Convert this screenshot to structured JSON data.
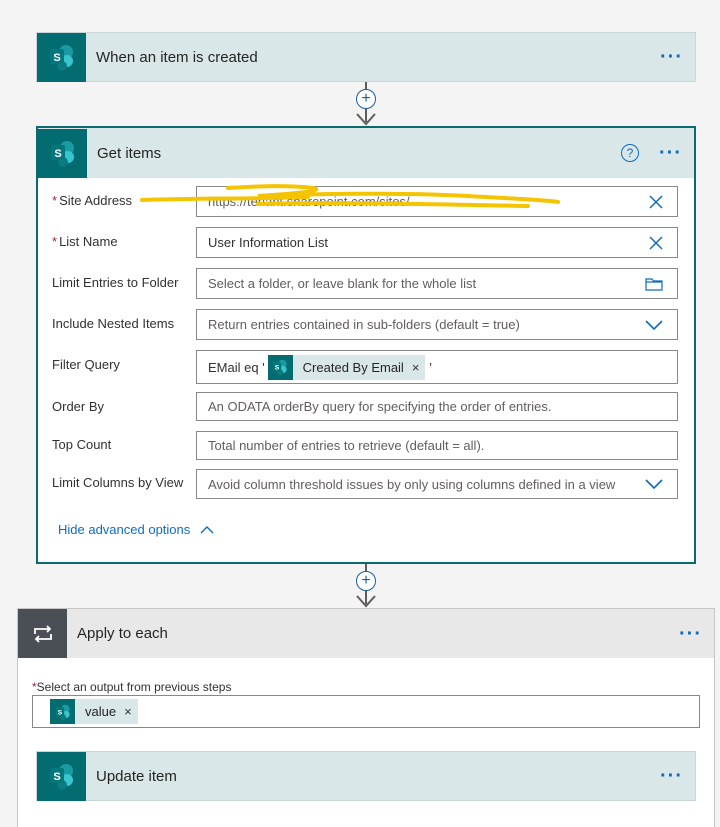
{
  "trigger": {
    "title": "When an item is created",
    "sp_letter": "S"
  },
  "get_items": {
    "title": "Get items",
    "help_glyph": "?",
    "fields": [
      {
        "label": "Site Address",
        "required": true,
        "value": "https://tenant.sharepoint.com/sites/...",
        "trail": "clear-icon"
      },
      {
        "label": "List Name",
        "required": true,
        "value": "User Information List",
        "trail": "clear-icon"
      },
      {
        "label": "Limit Entries to Folder",
        "required": false,
        "placeholder": "Select a folder, or leave blank for the whole list",
        "trail": "folder-icon"
      },
      {
        "label": "Include Nested Items",
        "required": false,
        "placeholder": "Return entries contained in sub-folders (default = true)",
        "trail": "chevron-down-icon"
      },
      {
        "label": "Filter Query",
        "required": false,
        "prefix": "EMail eq '",
        "token": "Created By Email",
        "suffix": "'"
      },
      {
        "label": "Order By",
        "required": false,
        "placeholder": "An ODATA orderBy query for specifying the order of entries."
      },
      {
        "label": "Top Count",
        "required": false,
        "placeholder": "Total number of entries to retrieve (default = all)."
      },
      {
        "label": "Limit Columns by View",
        "required": false,
        "placeholder": "Avoid column threshold issues by only using columns defined in a view",
        "trail": "chevron-down-icon"
      }
    ],
    "advanced_link": "Hide advanced options"
  },
  "apply_each": {
    "title": "Apply to each",
    "select_label": "Select an output from previous steps",
    "token": "value"
  },
  "update_item": {
    "title": "Update item"
  },
  "ui": {
    "more_glyph": "···",
    "remove_glyph": "×",
    "plus_glyph": "+",
    "required_mark": "*"
  },
  "colors": {
    "sharepoint": "#036c70",
    "header_bg": "#d9e7e8",
    "accent": "#0f6cbd",
    "highlight": "#f5c400"
  }
}
